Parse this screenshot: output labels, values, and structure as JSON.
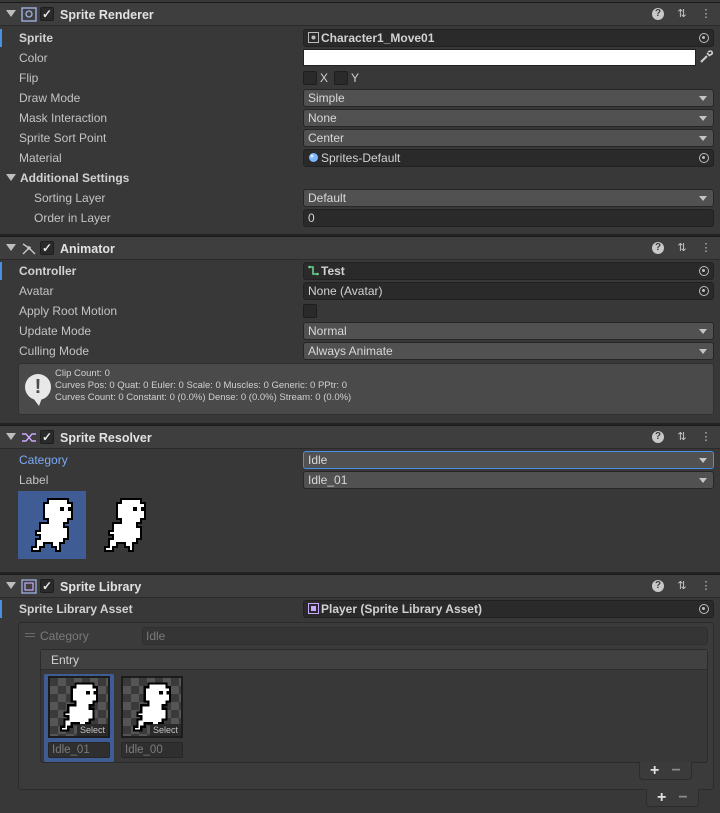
{
  "sprite_renderer": {
    "title": "Sprite Renderer",
    "enabled": "✓",
    "sprite_label": "Sprite",
    "sprite_value": "Character1_Move01",
    "color_label": "Color",
    "color_value": "#ffffff",
    "flip_label": "Flip",
    "flip_x": "X",
    "flip_y": "Y",
    "draw_mode_label": "Draw Mode",
    "draw_mode_value": "Simple",
    "mask_label": "Mask Interaction",
    "mask_value": "None",
    "sort_point_label": "Sprite Sort Point",
    "sort_point_value": "Center",
    "material_label": "Material",
    "material_value": "Sprites-Default",
    "additional_label": "Additional Settings",
    "sorting_layer_label": "Sorting Layer",
    "sorting_layer_value": "Default",
    "order_label": "Order in Layer",
    "order_value": "0"
  },
  "animator": {
    "title": "Animator",
    "enabled": "✓",
    "controller_label": "Controller",
    "controller_value": "Test",
    "avatar_label": "Avatar",
    "avatar_value": "None (Avatar)",
    "root_motion_label": "Apply Root Motion",
    "update_label": "Update Mode",
    "update_value": "Normal",
    "culling_label": "Culling Mode",
    "culling_value": "Always Animate",
    "info_line1": "Clip Count: 0",
    "info_line2": "Curves Pos: 0 Quat: 0 Euler: 0 Scale: 0 Muscles: 0 Generic: 0 PPtr: 0",
    "info_line3": "Curves Count: 0 Constant: 0 (0.0%) Dense: 0 (0.0%) Stream: 0 (0.0%)"
  },
  "sprite_resolver": {
    "title": "Sprite Resolver",
    "enabled": "✓",
    "category_label": "Category",
    "category_value": "Idle",
    "label_label": "Label",
    "label_value": "Idle_01"
  },
  "sprite_library": {
    "title": "Sprite Library",
    "enabled": "✓",
    "asset_label": "Sprite Library Asset",
    "asset_value": "Player (Sprite Library Asset)",
    "category_label": "Category",
    "category_value": "Idle",
    "entry_label": "Entry",
    "select_label": "Select",
    "entries": [
      {
        "name": "Idle_01"
      },
      {
        "name": "Idle_00"
      }
    ],
    "plus": "+",
    "minus": "−"
  },
  "header_icons": {
    "help": "?",
    "settings": "⇅",
    "menu": "⋮"
  },
  "colors": {
    "accent": "#4a90e2",
    "selection": "#3f5d94",
    "background": "#383838"
  }
}
